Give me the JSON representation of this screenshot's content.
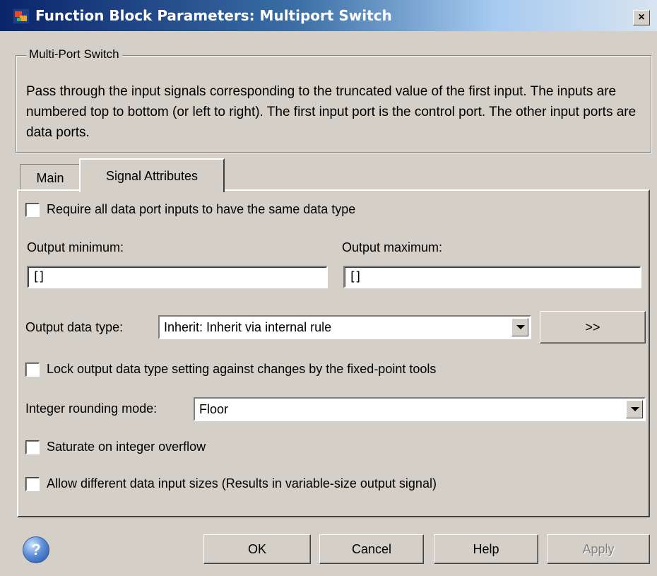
{
  "window": {
    "title": "Function Block Parameters: Multiport Switch",
    "close_label": "×"
  },
  "block": {
    "group_title": "Multi-Port Switch",
    "description": "Pass through the input signals corresponding to the truncated value of the first input. The inputs are numbered top to bottom (or left to right). The first input port is the control port. The other input ports are data ports."
  },
  "tabs": [
    {
      "label": "Main",
      "selected": false
    },
    {
      "label": "Signal Attributes",
      "selected": true
    }
  ],
  "signal_attributes": {
    "same_type_label": "Require all data port inputs to have the same data type",
    "output_minimum_label": "Output minimum:",
    "output_minimum_value": "[]",
    "output_maximum_label": "Output maximum:",
    "output_maximum_value": "[]",
    "output_data_type_label": "Output data type:",
    "output_data_type_value": "Inherit: Inherit via internal rule",
    "data_type_assistant_label": ">>",
    "lock_label": "Lock output data type setting against changes by the fixed-point tools",
    "rounding_label": "Integer rounding mode:",
    "rounding_value": "Floor",
    "saturate_label": "Saturate on integer overflow",
    "variable_size_label": "Allow different data input sizes (Results in variable-size output signal)"
  },
  "buttons": {
    "ok": "OK",
    "cancel": "Cancel",
    "help": "Help",
    "apply": "Apply",
    "help_icon": "?"
  }
}
